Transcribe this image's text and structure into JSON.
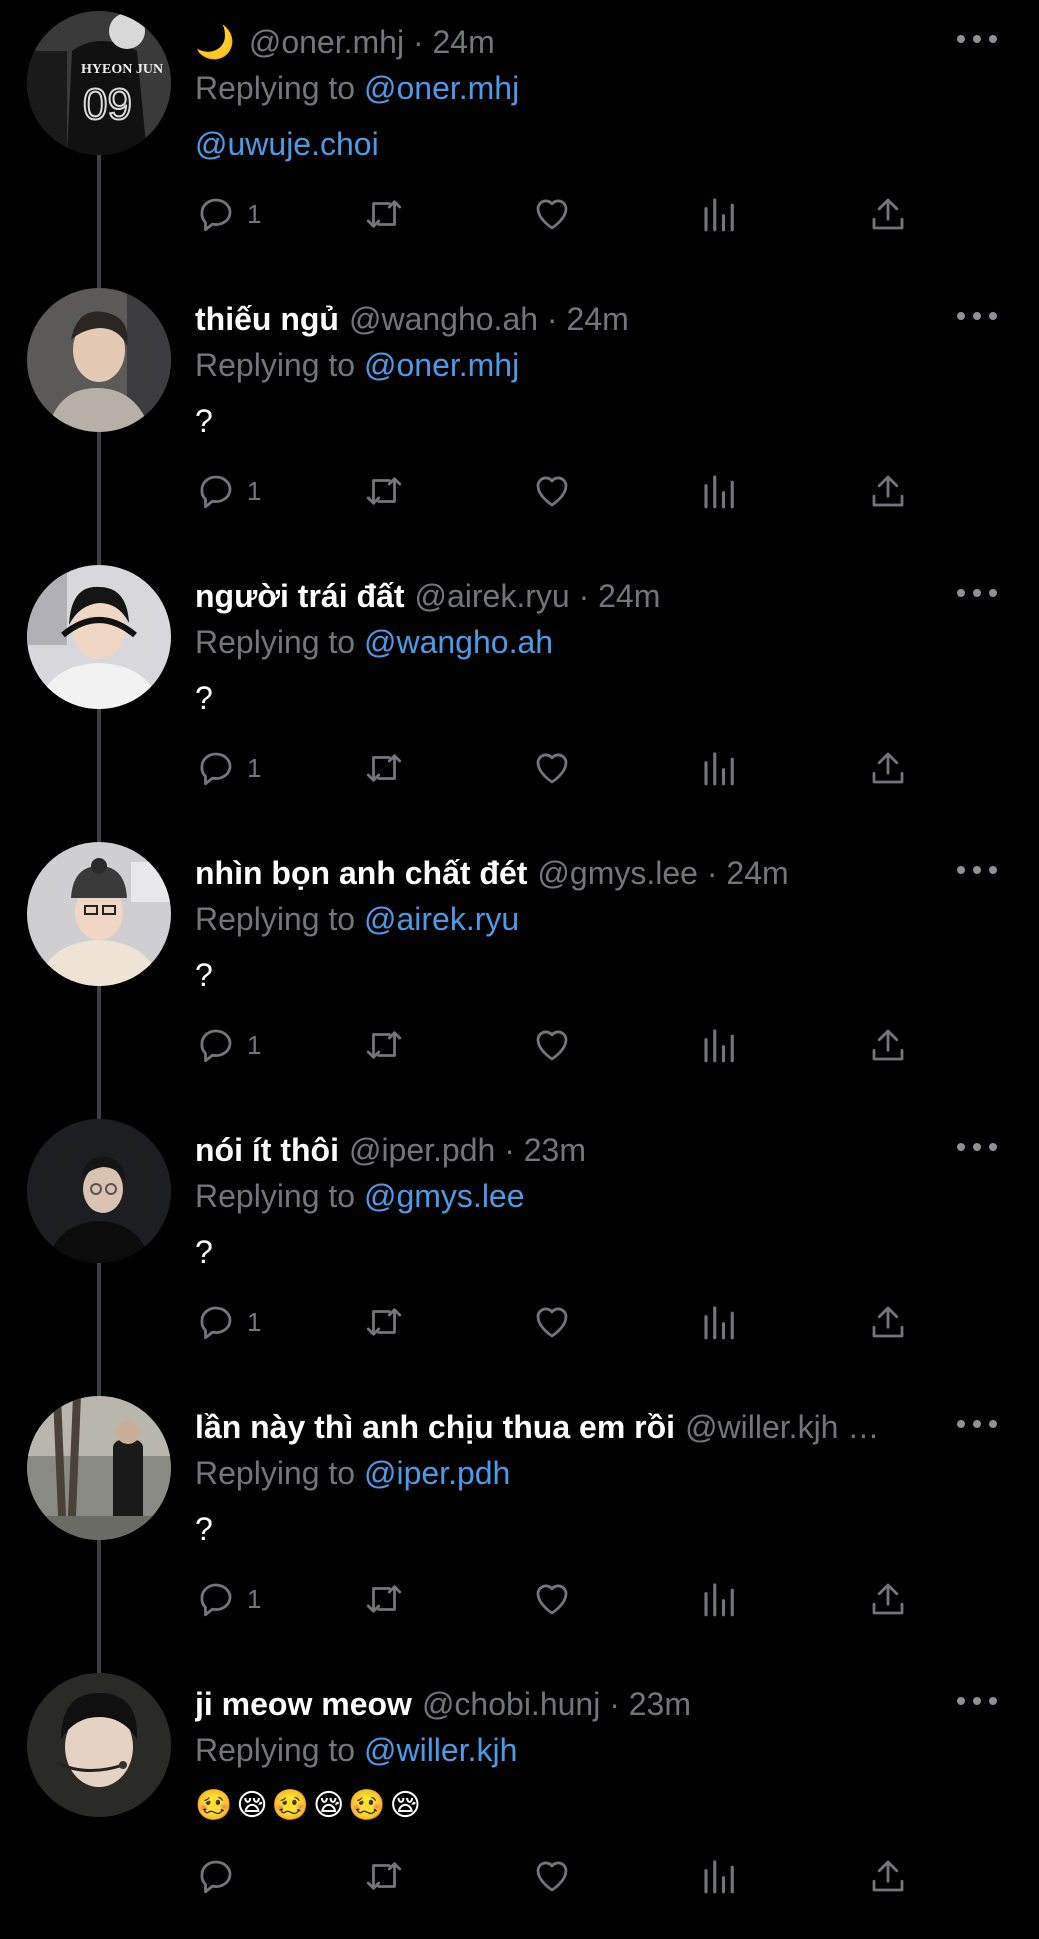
{
  "tweets": [
    {
      "name": "",
      "prefix": "🌙",
      "handle": "@oner.mhj · 24m",
      "reply_label": "Replying to",
      "reply_to": "@oner.mhj",
      "body": "@uwuje.choi",
      "reply_count": "1",
      "avatar": "jersey"
    },
    {
      "name": "thiếu ngủ",
      "handle": "@wangho.ah · 24m",
      "reply_label": "Replying to",
      "reply_to": "@oner.mhj",
      "body": "?",
      "reply_count": "1",
      "avatar": "hoodie"
    },
    {
      "name": "người trái đất",
      "handle": "@airek.ryu · 24m",
      "reply_label": "Replying to",
      "reply_to": "@wangho.ah",
      "body": "?",
      "reply_count": "1",
      "avatar": "headset"
    },
    {
      "name": "nhìn bọn anh chất đét",
      "handle": "@gmys.lee · 24m",
      "reply_label": "Replying to",
      "reply_to": "@airek.ryu",
      "body": "?",
      "reply_count": "1",
      "avatar": "beanie"
    },
    {
      "name": "nói ít thôi",
      "handle": "@iper.pdh · 23m",
      "reply_label": "Replying to",
      "reply_to": "@gmys.lee",
      "body": "?",
      "reply_count": "1",
      "avatar": "glasses"
    },
    {
      "name": "lần này thì anh chịu thua em rồi",
      "handle": "@willer.kjh …",
      "reply_label": "Replying to",
      "reply_to": "@iper.pdh",
      "body": "?",
      "reply_count": "1",
      "avatar": "street"
    },
    {
      "name": "ji meow meow",
      "handle": "@chobi.hunj · 23m",
      "reply_label": "Replying to",
      "reply_to": "@willer.kjh",
      "body": "🥴😪🥴😪🥴😪",
      "reply_count": "",
      "avatar": "mic"
    }
  ],
  "colors": {
    "background": "#000000",
    "link": "#4a9be8",
    "muted": "#71767b"
  }
}
